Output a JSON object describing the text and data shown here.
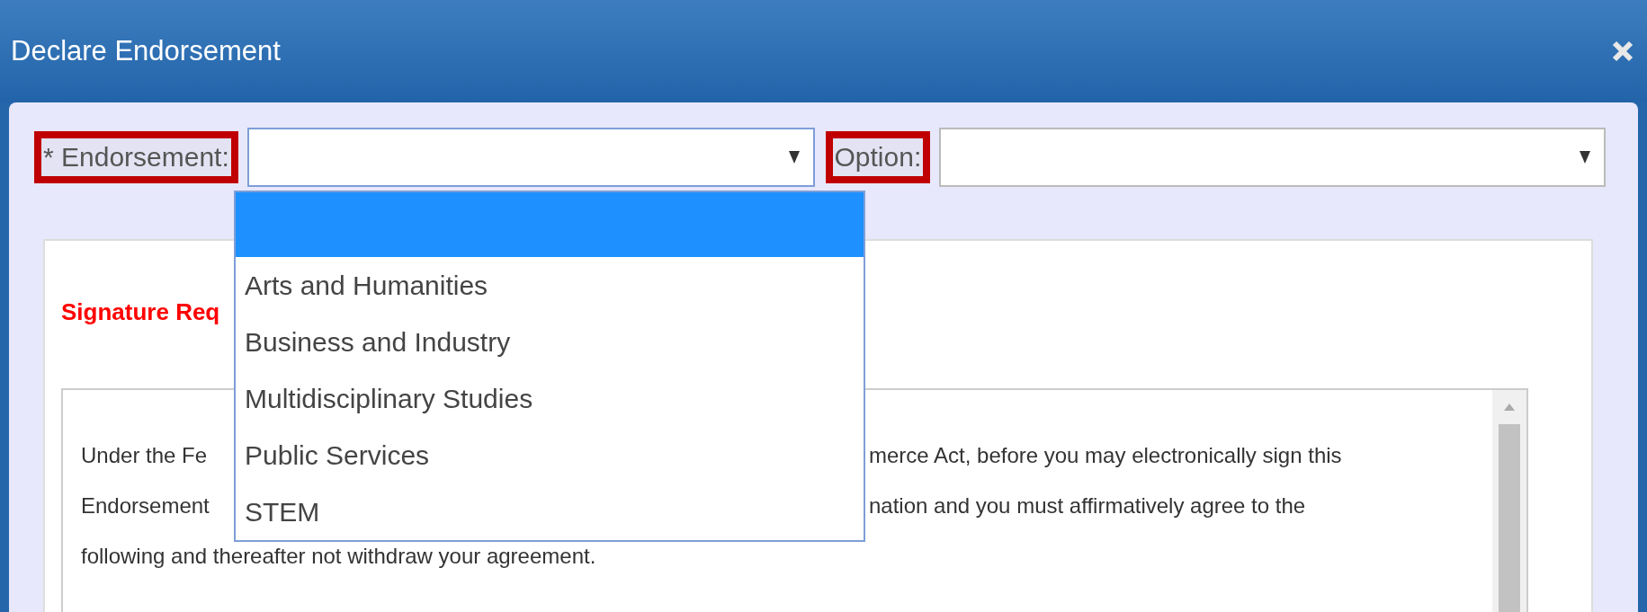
{
  "window": {
    "title": "Declare Endorsement"
  },
  "fields": [
    {
      "label": "* Endorsement:",
      "expanded": true
    },
    {
      "label": "Option:",
      "expanded": false
    }
  ],
  "dropdown": {
    "items": [
      {
        "selected": true
      },
      {
        "label": "Arts and Humanities",
        "selected": false
      },
      {
        "label": "Business and Industry",
        "selected": false
      },
      {
        "label": "Multidisciplinary Studies",
        "selected": false
      },
      {
        "label": "Public Services",
        "selected": false
      },
      {
        "label": "STEM",
        "selected": false
      }
    ]
  },
  "signature_heading": "Signature Req",
  "agreement_lines": [
    [
      "Under the Fe",
      "merce Act, before you may electronically sign this"
    ],
    [
      "Endorsement",
      "nation and you must affirmatively agree to the"
    ],
    [
      "following and thereafter not withdraw your agreement."
    ]
  ]
}
